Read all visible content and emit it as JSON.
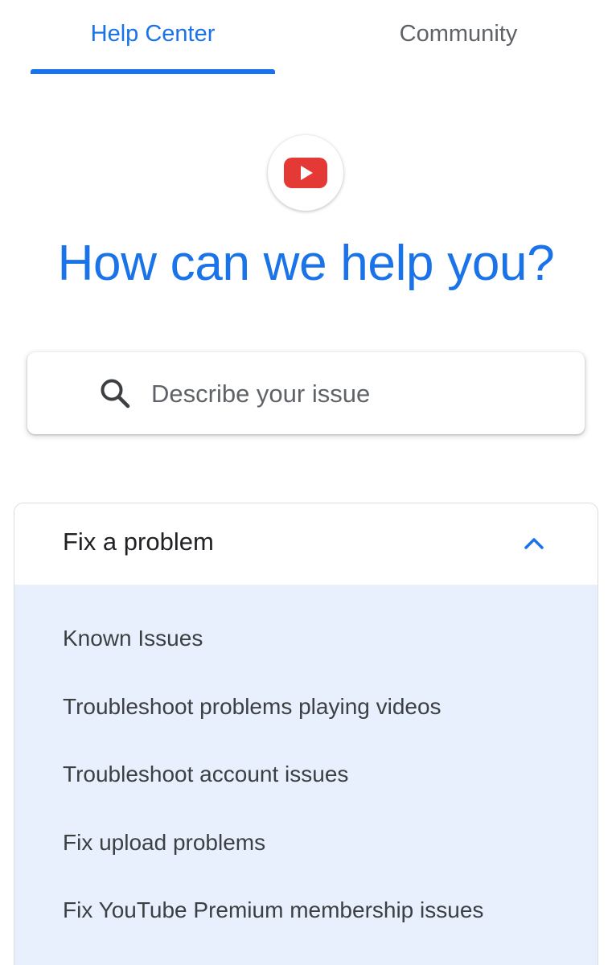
{
  "tabs": {
    "help_center": "Help Center",
    "community": "Community",
    "active": "help_center"
  },
  "logo": {
    "icon": "youtube-play-icon",
    "color": "#e53935"
  },
  "heading": "How can we help you?",
  "search": {
    "placeholder": "Describe your issue",
    "value": "",
    "icon": "search-icon"
  },
  "section": {
    "title": "Fix a problem",
    "expanded": true,
    "chevron_icon": "chevron-up-icon",
    "items": [
      "Known Issues",
      "Troubleshoot problems playing videos",
      "Troubleshoot account issues",
      "Fix upload problems",
      "Fix YouTube Premium membership issues"
    ]
  },
  "colors": {
    "accent": "#1a73e8",
    "section_background": "#e8f0fe",
    "text_primary": "#202124",
    "text_secondary": "#5f6368"
  }
}
